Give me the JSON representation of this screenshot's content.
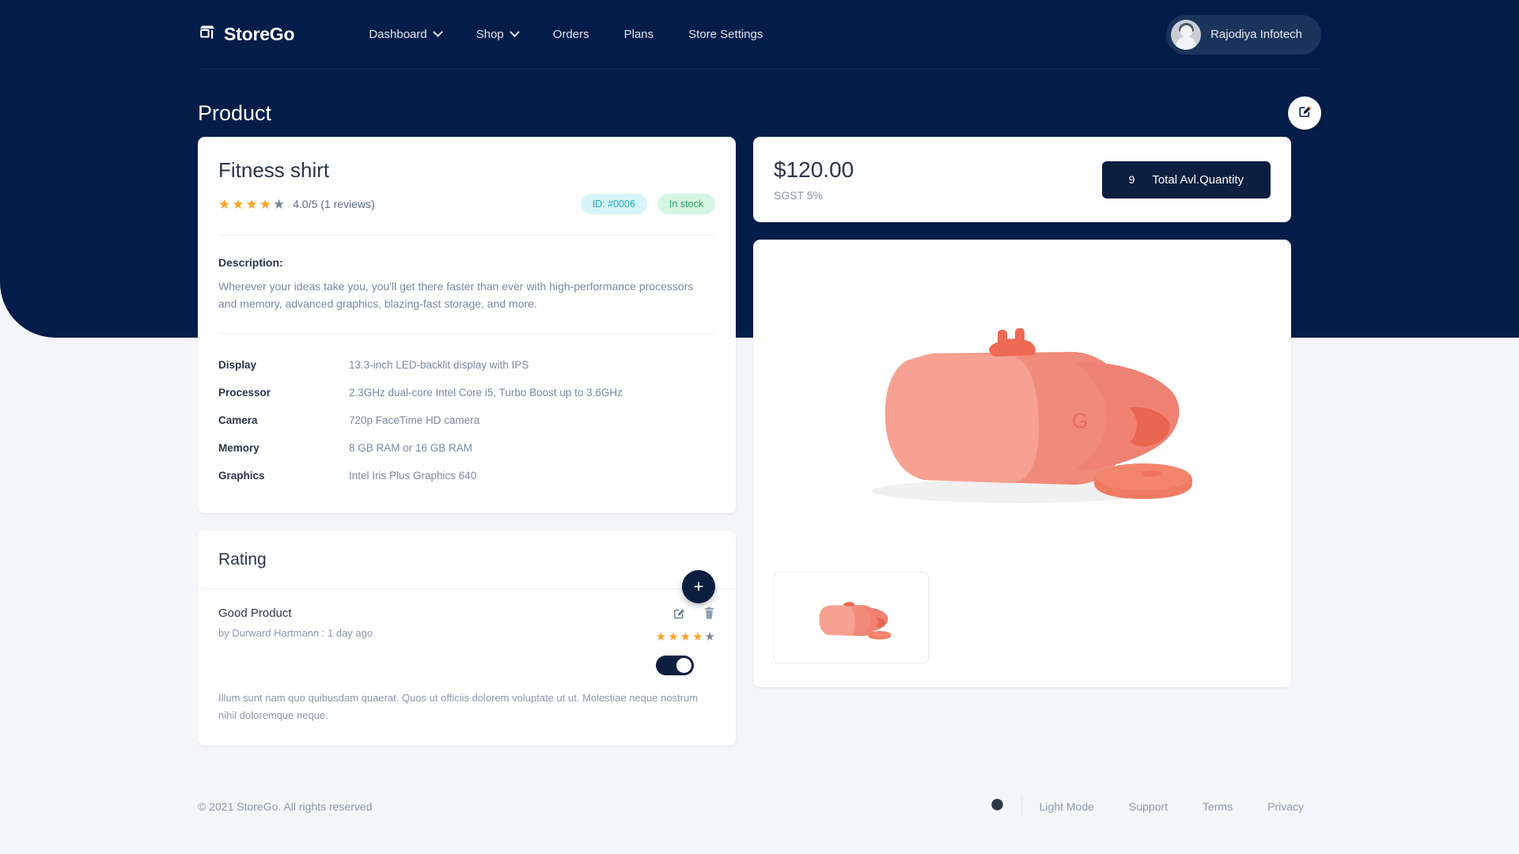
{
  "brand": {
    "name": "StoreGo",
    "logo_icon": "store-icon"
  },
  "nav": {
    "items": [
      {
        "label": "Dashboard",
        "has_caret": true
      },
      {
        "label": "Shop",
        "has_caret": true
      },
      {
        "label": "Orders",
        "has_caret": false
      },
      {
        "label": "Plans",
        "has_caret": false
      },
      {
        "label": "Store Settings",
        "has_caret": false
      }
    ],
    "user": {
      "name": "Rajodiya Infotech",
      "avatar_icon": "user-avatar"
    }
  },
  "page": {
    "title": "Product",
    "edit_icon": "edit-square-icon"
  },
  "product": {
    "name": "Fitness shirt",
    "rating_value": 4,
    "rating_max": 5,
    "rating_text": "4.0/5 (1 reviews)",
    "badge_id": "ID: #0006",
    "badge_stock": "In stock",
    "description_label": "Description:",
    "description": "Wherever your ideas take you, you'll get there faster than ever with high-performance processors and memory, advanced graphics, blazing-fast storage, and more.",
    "specs": [
      {
        "key": "Display",
        "value": "13.3-inch LED-backlit display with IPS"
      },
      {
        "key": "Processor",
        "value": "2.3GHz dual-core Intel Core i5, Turbo Boost up to 3.6GHz"
      },
      {
        "key": "Camera",
        "value": "720p FaceTime HD camera"
      },
      {
        "key": "Memory",
        "value": "8 GB RAM or 16 GB RAM"
      },
      {
        "key": "Graphics",
        "value": "Intel Iris Plus Graphics 640"
      }
    ]
  },
  "price_card": {
    "price": "$120.00",
    "tax": "SGST 5%",
    "quantity": "9",
    "quantity_label": "Total Avl.Quantity"
  },
  "rating_section": {
    "title": "Rating",
    "add_label": "+",
    "reviews": [
      {
        "title": "Good Product",
        "meta": "by Durward Hartmann : 1 day ago",
        "stars": 4,
        "stars_max": 5,
        "enabled": true,
        "body": "Illum sunt nam quo quibusdam quaerat. Quos ut officiis dolorem voluptate ut ut. Molestiae neque nostrum nihil doloremque neque.",
        "edit_icon": "edit-square-icon",
        "delete_icon": "trash-icon"
      }
    ]
  },
  "gallery": {
    "main_image_alt": "coral-vr-headset",
    "thumbnails": [
      {
        "alt": "coral-vr-headset-thumb"
      }
    ]
  },
  "footer": {
    "copyright": "© 2021 StoreGo. All rights reserved",
    "mode_icon": "dark-mode-icon",
    "links": [
      {
        "label": "Light Mode"
      },
      {
        "label": "Support"
      },
      {
        "label": "Terms"
      },
      {
        "label": "Privacy"
      }
    ]
  },
  "colors": {
    "header_bg": "#021d49",
    "page_bg": "#f5f6f9",
    "accent_navy": "#0c1f40",
    "star_on": "#fca326",
    "star_off": "#7c8699",
    "badge_id_bg": "#d7f5f8",
    "badge_id_fg": "#1aa7b8",
    "badge_stock_bg": "#d5f5e3",
    "badge_stock_fg": "#28a05c",
    "product_coral": "#f2806e"
  }
}
